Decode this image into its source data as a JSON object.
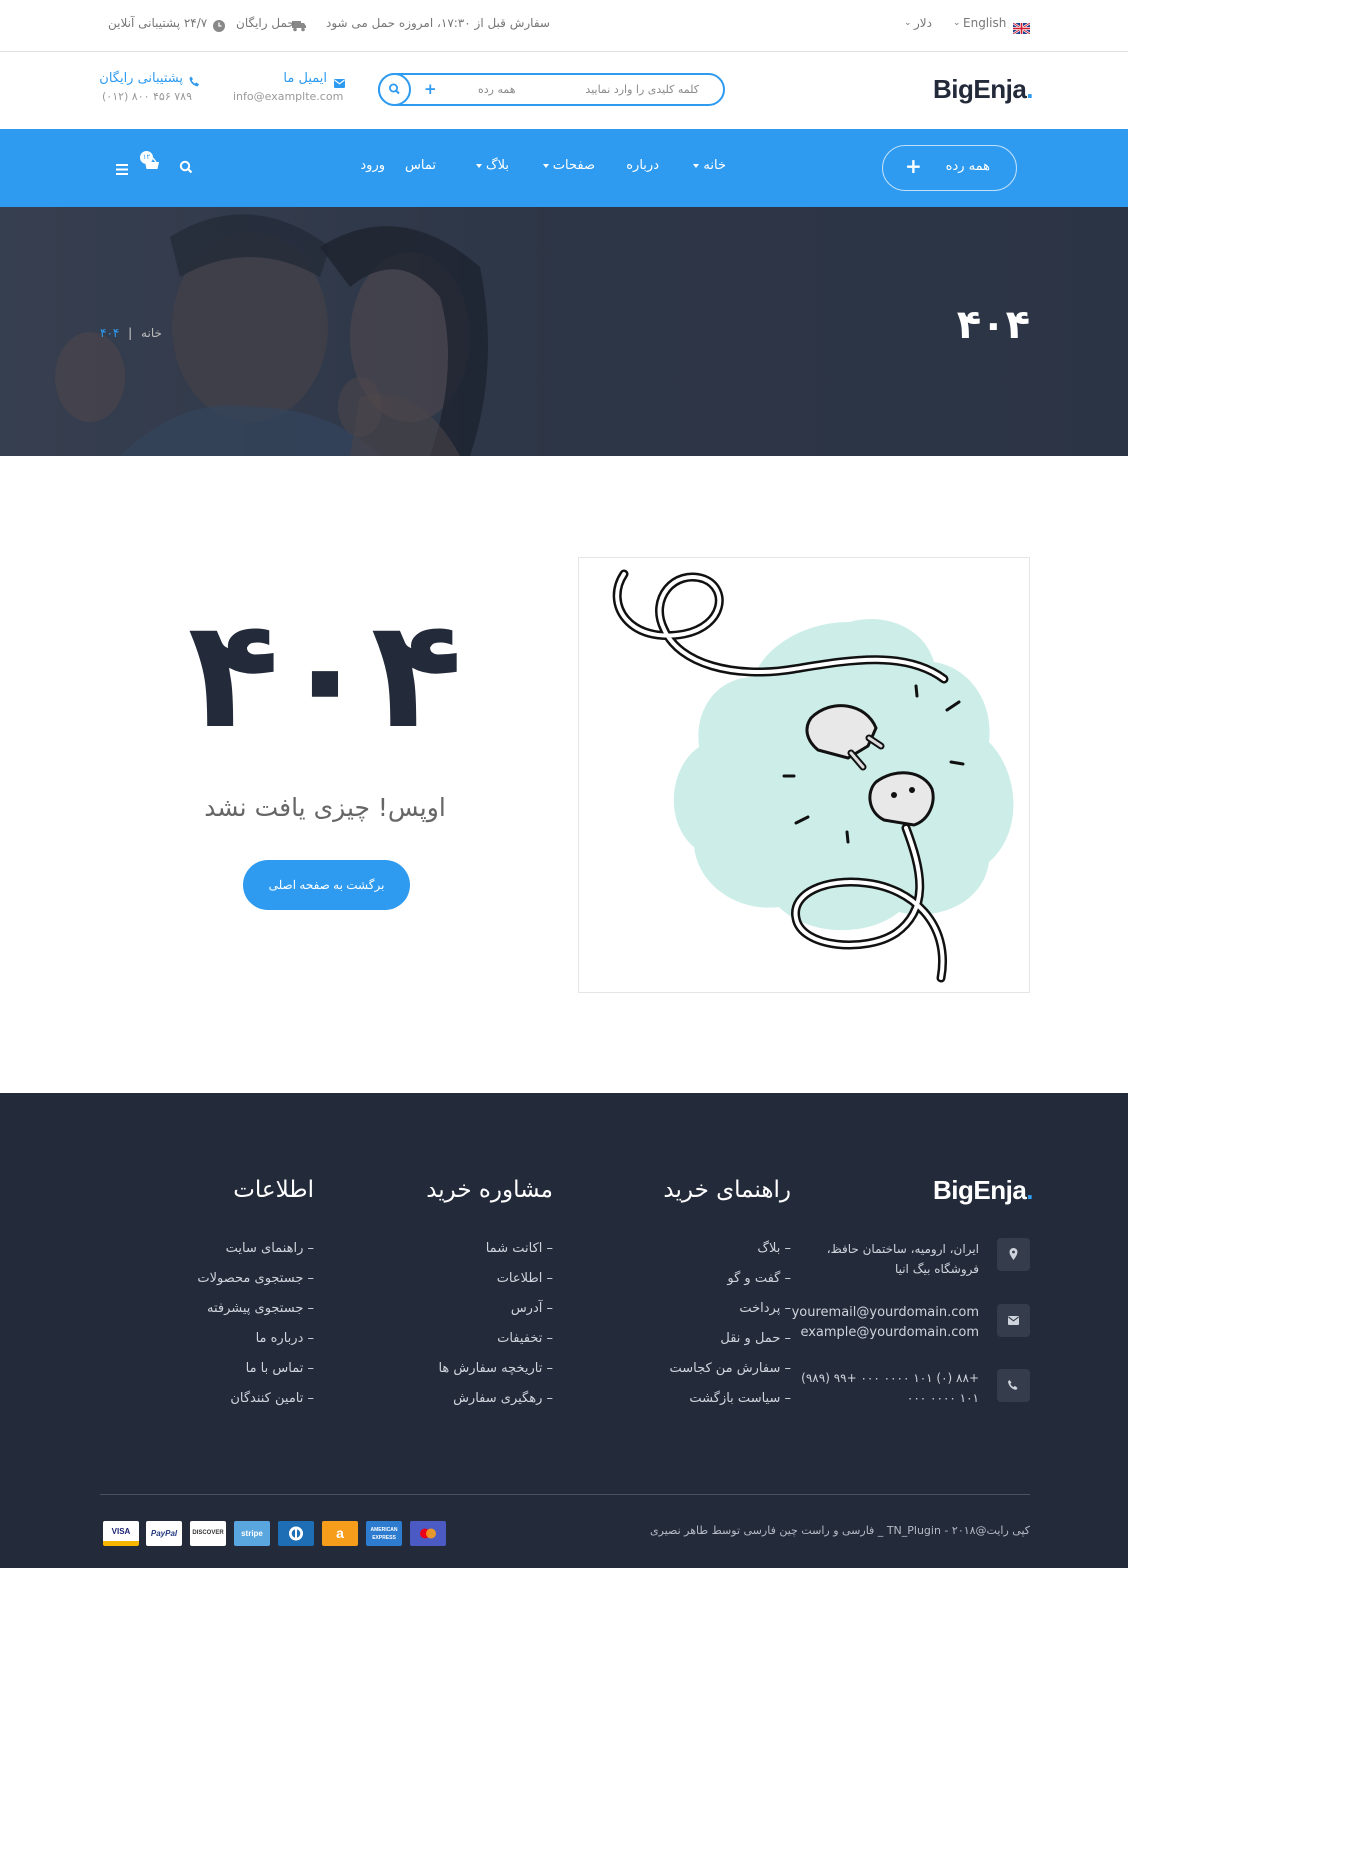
{
  "topbar": {
    "language": "English",
    "currency": "دلار",
    "order_notice": "سفارش قبل از ۱۷:۳۰، امروزه حمل می شود",
    "free_shipping": "حمل رایگان",
    "support_24": "۲۴/۷ پشتیبانی آنلاین"
  },
  "header": {
    "logo": "BigEnja",
    "logo_dot": ".",
    "search_placeholder": "کلمه کلیدی را وارد نمایید",
    "search_category": "همه رده",
    "search_plus": "+",
    "email_label": "ایمیل ما",
    "email_value": "info@examplte.com",
    "support_label": "پشتیبانی رایگان",
    "support_value": "(۰۱۲) ۸۰۰ ۴۵۶ ۷۸۹"
  },
  "nav": {
    "category_button": "همه رده",
    "category_plus": "+",
    "items": [
      "خانه",
      "درباره",
      "صفحات",
      "بلاگ",
      "تماس",
      "ورود"
    ],
    "cart_count": "۱۲"
  },
  "hero": {
    "title": "۴۰۴",
    "breadcrumb_home": "خانه",
    "breadcrumb_sep": "|",
    "breadcrumb_current": "۴۰۴"
  },
  "main": {
    "code": "۴۰۴",
    "message": "اوپس! چیزی یافت نشد",
    "home_button": "برگشت به صفحه اصلی"
  },
  "footer": {
    "logo": "BigEnja",
    "logo_dot": ".",
    "address_line1": "ایران، ارومیه، ساختمان حافظ،",
    "address_line2": "فروشگاه بیگ انیا",
    "email1": "youremail@yourdomain.com",
    "email2": "example@yourdomain.com",
    "phone1": "+۸۸ (۰) ۱۰۱ ۰۰۰۰ ۰۰۰ +۹۹ (۹۸۹)",
    "phone2": "۱۰۱ ۰۰۰۰ ۰۰۰",
    "col1_title": "راهنمای خرید",
    "col1_links": [
      "– بلاگ",
      "– گفت و گو",
      "– پرداخت",
      "– حمل و نقل",
      "– سفارش من کجاست",
      "– سیاست بازگشت"
    ],
    "col2_title": "مشاوره خرید",
    "col2_links": [
      "– اکانت شما",
      "– اطلاعات",
      "– آدرس",
      "– تخفیفات",
      "– تاریخچه سفارش ها",
      "– رهگیری سفارش"
    ],
    "col3_title": "اطلاعات",
    "col3_links": [
      "– راهنمای سایت",
      "– جستجوی محصولات",
      "– جستجوی پیشرفته",
      "– درباره ما",
      "– تماس با ما",
      "– تامین کنندگان"
    ],
    "copyright": "کپی رایت@۲۰۱۸ - TN_Plugin _ فارسی و راست چین فارسی توسط طاهر نصیری",
    "payments": [
      "VISA",
      "PayPal",
      "DISCOVER",
      "stripe",
      "",
      "a",
      "AMERICAN EXPRESS",
      ""
    ]
  },
  "colors": {
    "accent": "#2e9bf0",
    "dark": "#232a3a"
  }
}
